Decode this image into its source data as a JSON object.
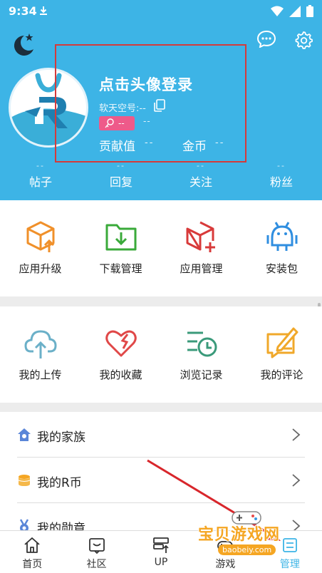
{
  "status_bar": {
    "time": "9:34"
  },
  "profile": {
    "login_title": "点击头像登录",
    "ruan_id": "软天空号:--",
    "level": "--",
    "level_extra": "--",
    "contribution_label": "贡献值",
    "contribution_value": "--",
    "coins_label": "金币",
    "coins_value": "--"
  },
  "stats": [
    {
      "value": "--",
      "label": "帖子"
    },
    {
      "value": "--",
      "label": "回复"
    },
    {
      "value": "--",
      "label": "关注"
    },
    {
      "value": "--",
      "label": "粉丝"
    }
  ],
  "apps_grid": [
    {
      "label": "应用升级",
      "icon": "box-upload-icon"
    },
    {
      "label": "下载管理",
      "icon": "folder-download-icon"
    },
    {
      "label": "应用管理",
      "icon": "box-add-icon"
    },
    {
      "label": "安装包",
      "icon": "android-icon"
    }
  ],
  "personal_grid": [
    {
      "label": "我的上传",
      "icon": "cloud-upload-icon"
    },
    {
      "label": "我的收藏",
      "icon": "heart-icon"
    },
    {
      "label": "浏览记录",
      "icon": "history-list-icon"
    },
    {
      "label": "我的评论",
      "icon": "comment-edit-icon"
    }
  ],
  "list": [
    {
      "label": "我的家族",
      "icon": "family-house-icon"
    },
    {
      "label": "我的R币",
      "icon": "coin-stack-icon"
    },
    {
      "label": "我的勋章",
      "icon": "medal-icon"
    }
  ],
  "tabbar": [
    {
      "label": "首页",
      "icon": "home-icon"
    },
    {
      "label": "社区",
      "icon": "community-icon"
    },
    {
      "label": "UP",
      "icon": "up-server-icon"
    },
    {
      "label": "游戏",
      "icon": "game-icon"
    },
    {
      "label": "管理",
      "icon": "manage-icon"
    }
  ],
  "watermark": {
    "text": "宝贝游戏网",
    "url": "baobeiy.com"
  },
  "colors": {
    "header": "#3db4e6",
    "highlight_box": "#d43a3a",
    "badge": "#ee5a8a",
    "annotation_arrow": "#d8262b"
  }
}
